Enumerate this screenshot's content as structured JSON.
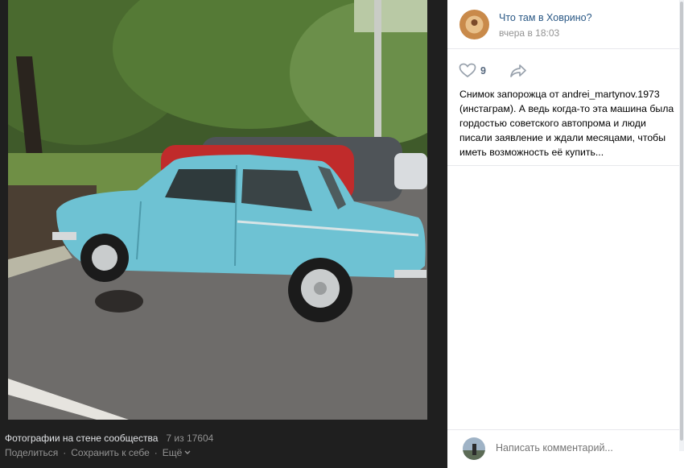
{
  "viewer": {
    "caption_title": "Фотографии на стене сообщества",
    "counter": "7 из 17604",
    "actions": {
      "share": "Поделиться",
      "save": "Сохранить к себе",
      "more": "Ещё"
    }
  },
  "post": {
    "group_name": "Что там в Ховрино?",
    "time": "вчера в 18:03",
    "likes": "9",
    "text": "Снимок запорожца от andrei_martynov.1973 (инстаграм). А ведь когда-то эта машина была гордостью советского автопрома и люди писали заявление и ждали месяцами, чтобы иметь возможность её купить..."
  },
  "comment": {
    "placeholder": "Написать комментарий..."
  },
  "icons": {
    "like": "heart-icon",
    "share": "share-arrow-icon",
    "more": "chevron-down-icon"
  },
  "colors": {
    "viewer_bg": "#1f1f1f",
    "link": "#2a5885",
    "muted": "#939393"
  }
}
